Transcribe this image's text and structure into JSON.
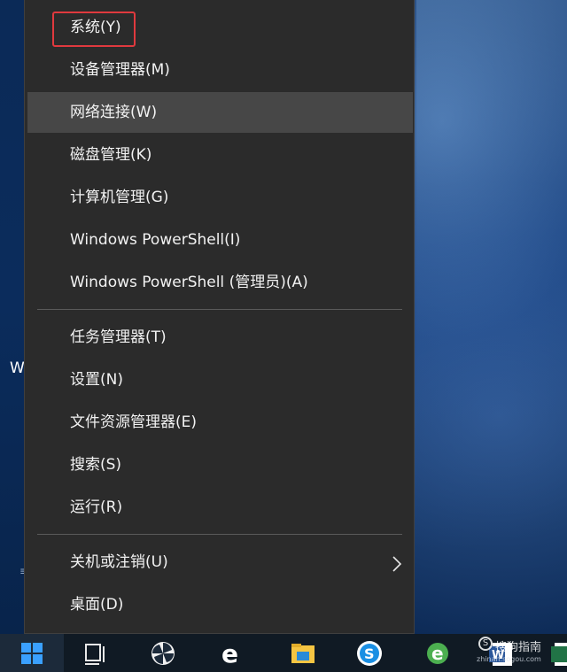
{
  "desktop": {
    "edge_text": "W",
    "edge_mark": "≡"
  },
  "menu": {
    "group1": [
      {
        "label": "系统(Y)"
      },
      {
        "label": "设备管理器(M)"
      },
      {
        "label": "网络连接(W)"
      },
      {
        "label": "磁盘管理(K)"
      },
      {
        "label": "计算机管理(G)"
      },
      {
        "label": "Windows PowerShell(I)"
      },
      {
        "label": "Windows PowerShell (管理员)(A)"
      }
    ],
    "group2": [
      {
        "label": "任务管理器(T)"
      },
      {
        "label": "设置(N)"
      },
      {
        "label": "文件资源管理器(E)"
      },
      {
        "label": "搜索(S)"
      },
      {
        "label": "运行(R)"
      }
    ],
    "group3": [
      {
        "label": "关机或注销(U)"
      },
      {
        "label": "桌面(D)"
      }
    ],
    "hovered_item": "网络连接(W)",
    "highlighted_item": "系统(Y)",
    "submenu_icon": "chevron-right-icon"
  },
  "taskbar": {
    "icons": [
      "windows-start-icon",
      "task-view-icon",
      "pinwheel-app-icon",
      "edge-browser-icon",
      "file-explorer-icon",
      "sogou-browser-icon",
      "ie-browser-icon",
      "word-icon",
      "excel-icon"
    ]
  },
  "watermark": {
    "title": "搜狗指南",
    "url": "zhinan.sogou.com"
  },
  "colors": {
    "menu_bg": "#2b2b2b",
    "menu_hover": "#474747",
    "highlight_border": "#e0393e",
    "taskbar_bg": "#101a24"
  }
}
